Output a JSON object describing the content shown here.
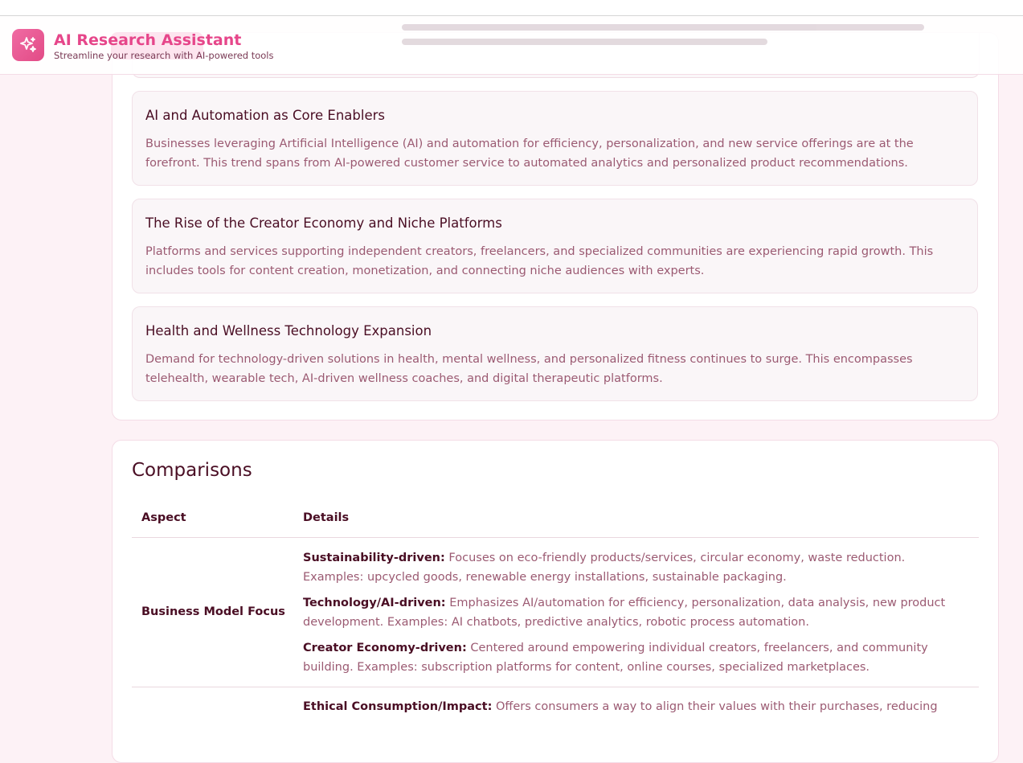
{
  "header": {
    "title": "AI Research Assistant",
    "subtitle": "Streamline your research with AI-powered tools"
  },
  "trends": [
    {
      "title": "AI and Automation as Core Enablers",
      "description": "Businesses leveraging Artificial Intelligence (AI) and automation for efficiency, personalization, and new service offerings are at the forefront. This trend spans from AI-powered customer service to automated analytics and personalized product recommendations."
    },
    {
      "title": "The Rise of the Creator Economy and Niche Platforms",
      "description": "Platforms and services supporting independent creators, freelancers, and specialized communities are experiencing rapid growth. This includes tools for content creation, monetization, and connecting niche audiences with experts."
    },
    {
      "title": "Health and Wellness Technology Expansion",
      "description": "Demand for technology-driven solutions in health, mental wellness, and personalized fitness continues to surge. This encompasses telehealth, wearable tech, AI-driven wellness coaches, and digital therapeutic platforms."
    }
  ],
  "comparisons": {
    "title": "Comparisons",
    "columns": {
      "aspect": "Aspect",
      "details": "Details"
    },
    "rows": [
      {
        "aspect": "Business Model Focus",
        "details": [
          {
            "label": "Sustainability-driven:",
            "text": " Focuses on eco-friendly products/services, circular economy, waste reduction. Examples: upcycled goods, renewable energy installations, sustainable packaging."
          },
          {
            "label": "Technology/AI-driven:",
            "text": " Emphasizes AI/automation for efficiency, personalization, data analysis, new product development. Examples: AI chatbots, predictive analytics, robotic process automation."
          },
          {
            "label": "Creator Economy-driven:",
            "text": " Centered around empowering individual creators, freelancers, and community building. Examples: subscription platforms for content, online courses, specialized marketplaces."
          }
        ]
      },
      {
        "aspect": "",
        "details": [
          {
            "label": "Ethical Consumption/Impact:",
            "text": " Offers consumers a way to align their values with their purchases, reducing"
          }
        ]
      }
    ]
  }
}
